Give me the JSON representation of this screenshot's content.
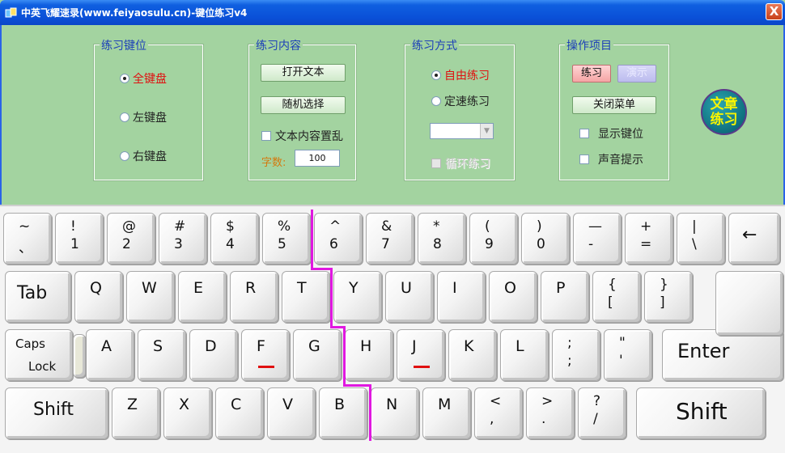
{
  "window": {
    "title": "中英飞耀速录(www.feiyaosulu.cn)-键位练习v4",
    "close": "X"
  },
  "groups": {
    "keys": {
      "title": "练习键位",
      "options": [
        "全键盘",
        "左键盘",
        "右键盘"
      ],
      "selected": "全键盘",
      "selected_color": "#e01010"
    },
    "content": {
      "title": "练习内容",
      "open_text": "打开文本",
      "random_select": "随机选择",
      "shuffle": "文本内容置乱",
      "count_label": "字数:",
      "count_value": "100"
    },
    "mode": {
      "title": "练习方式",
      "options": [
        "自由练习",
        "定速练习"
      ],
      "selected": "自由练习",
      "loop": "循环练习"
    },
    "actions": {
      "title": "操作项目",
      "practice": "练习",
      "demo": "演示",
      "close_menu": "关闭菜单",
      "show_keys": "显示键位",
      "sound": "声音提示"
    },
    "article": "文章\n练习"
  },
  "keyboard": {
    "row1": [
      {
        "top": "~",
        "bot": "、"
      },
      {
        "top": "!",
        "bot": "1"
      },
      {
        "top": "@",
        "bot": "2"
      },
      {
        "top": "#",
        "bot": "3"
      },
      {
        "top": "$",
        "bot": "4"
      },
      {
        "top": "%",
        "bot": "5"
      },
      {
        "top": "^",
        "bot": "6"
      },
      {
        "top": "&",
        "bot": "7"
      },
      {
        "top": "*",
        "bot": "8"
      },
      {
        "top": "(",
        "bot": "9"
      },
      {
        "top": ")",
        "bot": "0"
      },
      {
        "top": "—",
        "bot": "-"
      },
      {
        "top": "+",
        "bot": "="
      },
      {
        "top": "|",
        "bot": "\\"
      },
      {
        "mid": "←"
      }
    ],
    "row2": [
      {
        "mid": "Tab"
      },
      {
        "mid": "Q"
      },
      {
        "mid": "W"
      },
      {
        "mid": "E"
      },
      {
        "mid": "R"
      },
      {
        "mid": "T"
      },
      {
        "mid": "Y"
      },
      {
        "mid": "U"
      },
      {
        "mid": "I"
      },
      {
        "mid": "O"
      },
      {
        "mid": "P"
      },
      {
        "top": "{",
        "bot": "["
      },
      {
        "top": "}",
        "bot": "]"
      }
    ],
    "row3": [
      {
        "top": "Caps",
        "bot": "Lock"
      },
      {
        "mid": "A"
      },
      {
        "mid": "S"
      },
      {
        "mid": "D"
      },
      {
        "mid": "F"
      },
      {
        "mid": "G"
      },
      {
        "mid": "H"
      },
      {
        "mid": "J"
      },
      {
        "mid": "K"
      },
      {
        "mid": "L"
      },
      {
        "top": ";",
        "bot": ";"
      },
      {
        "top": "\"",
        "bot": "'"
      },
      {
        "mid": "Enter"
      }
    ],
    "row4": [
      {
        "mid": "Shift"
      },
      {
        "mid": "Z"
      },
      {
        "mid": "X"
      },
      {
        "mid": "C"
      },
      {
        "mid": "V"
      },
      {
        "mid": "B"
      },
      {
        "mid": "N"
      },
      {
        "mid": "M"
      },
      {
        "top": "<",
        "bot": ","
      },
      {
        "top": ">",
        "bot": "."
      },
      {
        "top": "?",
        "bot": "/"
      },
      {
        "mid": "Shift"
      }
    ]
  },
  "colors": {
    "divider": "#e018e0",
    "home_marker": "#e01010",
    "panel_bg": "#a3d3a0"
  }
}
